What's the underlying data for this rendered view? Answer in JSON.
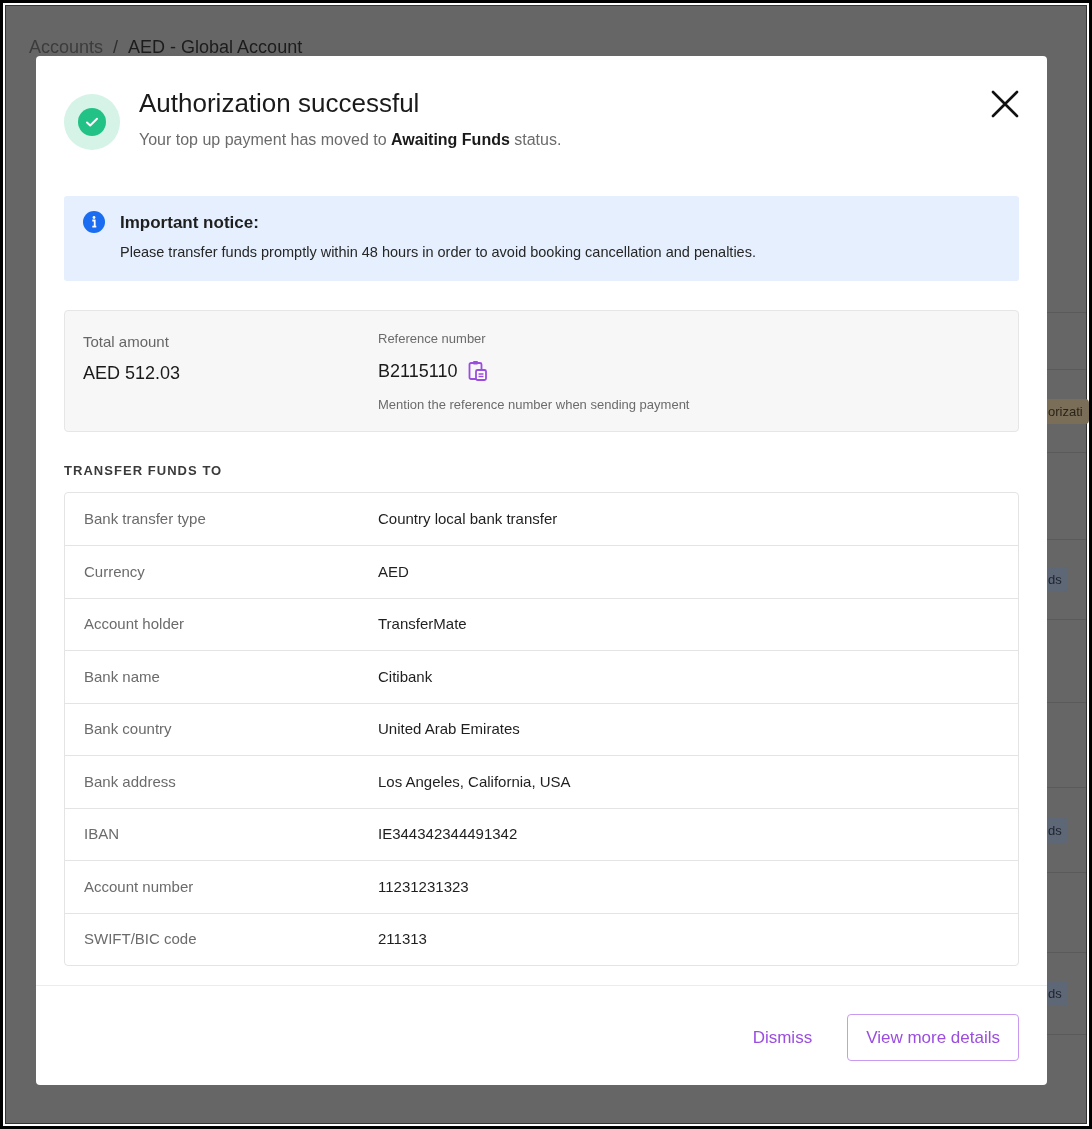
{
  "background": {
    "breadcrumb": [
      {
        "label": "Accounts",
        "current": false
      },
      {
        "label": "AED - Global Account",
        "current": true
      }
    ],
    "separator": "/",
    "rows": [
      {
        "badge": null
      },
      {
        "badge": {
          "text": "orizati",
          "kind": "warning"
        }
      },
      {
        "badge": null
      },
      {
        "badge": {
          "text": "ds",
          "kind": "info"
        }
      },
      {
        "badge": null
      },
      {
        "badge": null
      },
      {
        "badge": {
          "text": "ds",
          "kind": "info"
        }
      },
      {
        "badge": null
      },
      {
        "badge": {
          "text": "ds",
          "kind": "info"
        }
      }
    ]
  },
  "modal": {
    "title": "Authorization successful",
    "subtitle": "Your top up payment has moved to **Awaiting Funds** status.",
    "notice": {
      "title": "Important notice:",
      "body": "Please transfer funds promptly within 48 hours in order to avoid booking cancellation and penalties."
    },
    "summary": {
      "total_label": "Total amount",
      "total_value": "AED 512.03",
      "reference_label": "Reference number",
      "reference_value": "B2115110",
      "reference_hint": "Mention the reference number when sending payment"
    },
    "section_title": "TRANSFER FUNDS TO",
    "details": [
      {
        "label": "Bank transfer type",
        "value": "Country local bank transfer"
      },
      {
        "label": "Currency",
        "value": "AED"
      },
      {
        "label": "Account holder",
        "value": "TransferMate"
      },
      {
        "label": "Bank name",
        "value": "Citibank"
      },
      {
        "label": "Bank country",
        "value": "United Arab Emirates"
      },
      {
        "label": "Bank address",
        "value": "Los Angeles, California, USA"
      },
      {
        "label": "IBAN",
        "value": "IE344342344491342"
      },
      {
        "label": "Account number",
        "value": "11231231323"
      },
      {
        "label": "SWIFT/BIC code",
        "value": "211313"
      }
    ],
    "buttons": [
      {
        "label": "Dismiss",
        "kind": "text"
      },
      {
        "label": "View more details",
        "kind": "outline"
      }
    ]
  }
}
